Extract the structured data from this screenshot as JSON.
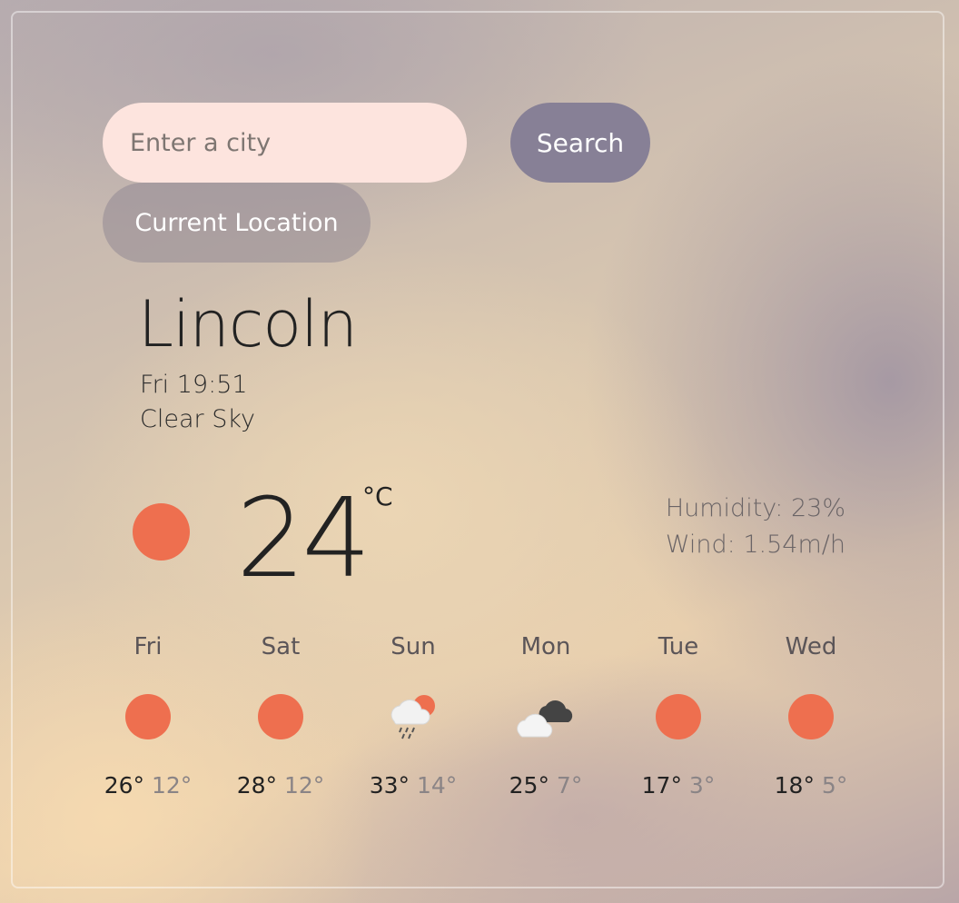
{
  "search": {
    "placeholder": "Enter a city",
    "button_label": "Search",
    "location_button_label": "Current Location"
  },
  "current": {
    "city": "Lincoln",
    "datetime": "Fri 19:51",
    "description": "Clear Sky",
    "temperature": "24",
    "unit": "°C",
    "icon": "sun-icon",
    "humidity": "Humidity: 23%",
    "wind": "Wind: 1.54m/h"
  },
  "forecast": [
    {
      "day": "Fri",
      "icon": "sun-icon",
      "max": "26°",
      "min": "12°"
    },
    {
      "day": "Sat",
      "icon": "sun-icon",
      "max": "28°",
      "min": "12°"
    },
    {
      "day": "Sun",
      "icon": "rain-sun-cloud-icon",
      "max": "33°",
      "min": "14°"
    },
    {
      "day": "Mon",
      "icon": "dark-clouds-icon",
      "max": "25°",
      "min": "7°"
    },
    {
      "day": "Tue",
      "icon": "sun-icon",
      "max": "17°",
      "min": "3°"
    },
    {
      "day": "Wed",
      "icon": "sun-icon",
      "max": "18°",
      "min": "5°"
    }
  ],
  "colors": {
    "sun": "#ee6f4f",
    "search_button": "#878096",
    "input_bg": "#fde4de"
  }
}
